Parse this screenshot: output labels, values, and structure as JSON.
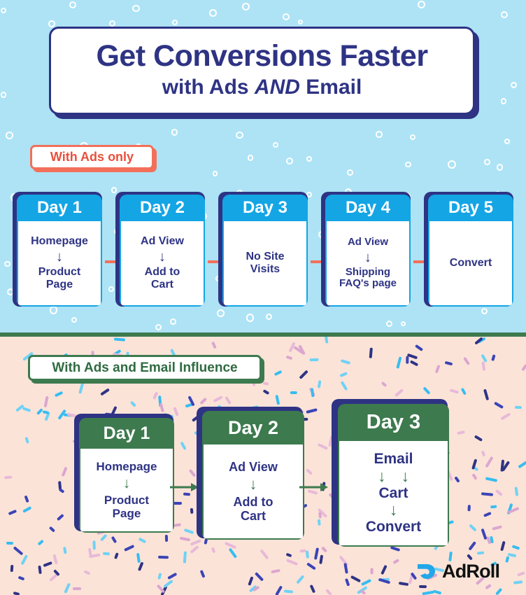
{
  "title": {
    "line1": "Get Conversions Faster",
    "line2_pre": "with Ads ",
    "line2_em": "AND",
    "line2_post": " Email"
  },
  "sections": [
    {
      "badge": "With Ads only",
      "accent": "#14a5e5",
      "arrow_color": "#f2705a",
      "cards": [
        {
          "day": "Day 1",
          "steps": [
            "Homepage",
            "Product Page"
          ]
        },
        {
          "day": "Day 2",
          "steps": [
            "Ad View",
            "Add to Cart"
          ]
        },
        {
          "day": "Day 3",
          "steps": [
            "No Site Visits"
          ]
        },
        {
          "day": "Day 4",
          "steps": [
            "Ad View",
            "Shipping FAQ's page"
          ]
        },
        {
          "day": "Day 5",
          "steps": [
            "Convert"
          ]
        }
      ]
    },
    {
      "badge": "With Ads and Email Influence",
      "accent": "#3d7a4e",
      "arrow_color": "#3d7a4e",
      "cards": [
        {
          "day": "Day 1",
          "steps": [
            "Homepage",
            "Product Page"
          ]
        },
        {
          "day": "Day 2",
          "steps": [
            "Ad View",
            "Add to Cart"
          ]
        },
        {
          "day": "Day 3",
          "steps": [
            "Email",
            "Cart",
            "Convert"
          ]
        }
      ]
    }
  ],
  "cards_top": {
    "day1_step1": "Homepage",
    "day1_step2_a": "Product",
    "day1_step2_b": "Page",
    "day2_step1": "Ad View",
    "day2_step2_a": "Add to",
    "day2_step2_b": "Cart",
    "day3_step1_a": "No Site",
    "day3_step1_b": "Visits",
    "day4_step1": "Ad View",
    "day4_step2_a": "Shipping",
    "day4_step2_b": "FAQ's page",
    "day5_step1": "Convert",
    "day1_label": "Day 1",
    "day2_label": "Day 2",
    "day3_label": "Day 3",
    "day4_label": "Day 4",
    "day5_label": "Day 5"
  },
  "cards_bottom": {
    "day1_label": "Day 1",
    "day2_label": "Day 2",
    "day3_label": "Day 3",
    "day1_step1": "Homepage",
    "day1_step2_a": "Product",
    "day1_step2_b": "Page",
    "day2_step1": "Ad View",
    "day2_step2_a": "Add to",
    "day2_step2_b": "Cart",
    "day3_step1": "Email",
    "day3_step2": "Cart",
    "day3_step3": "Convert"
  },
  "glyphs": {
    "down_arrow": "↓"
  },
  "logo": {
    "word": "AdRoll",
    "mark_color": "#22a7e8",
    "word_color": "#111111"
  },
  "colors": {
    "navy": "#2e3384",
    "blue_header": "#14a5e5",
    "blue_bg": "#ade3f5",
    "green": "#3d7a4e",
    "peach_bg": "#fbe3d8",
    "coral": "#f2705a"
  }
}
